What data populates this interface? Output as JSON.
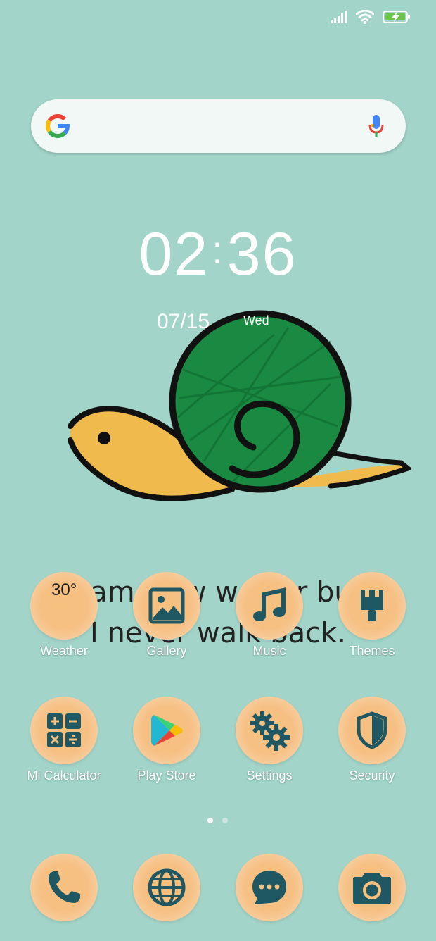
{
  "colors": {
    "background": "#a2d4c9",
    "icon_fill": "#f6c07e",
    "icon_glyph": "#1f5763",
    "battery": "#6ac744"
  },
  "status_bar": {
    "icons": [
      "signal-icon",
      "wifi-icon",
      "battery-charging-icon"
    ]
  },
  "search": {
    "logo": "google-g-logo",
    "mic": "microphone-icon"
  },
  "clock": {
    "hours": "02",
    "separator": ":",
    "minutes": "36",
    "date": "07/15",
    "weekday": "Wed"
  },
  "wallpaper": {
    "quote_line1": "I am slow walker but",
    "quote_line2": "I never walk back."
  },
  "apps_row1": [
    {
      "label": "Weather",
      "icon": "weather-icon",
      "value": "30°"
    },
    {
      "label": "Gallery",
      "icon": "gallery-icon"
    },
    {
      "label": "Music",
      "icon": "music-icon"
    },
    {
      "label": "Themes",
      "icon": "themes-icon"
    }
  ],
  "apps_row2": [
    {
      "label": "Mi Calculator",
      "icon": "calculator-icon"
    },
    {
      "label": "Play Store",
      "icon": "play-store-icon"
    },
    {
      "label": "Settings",
      "icon": "settings-icon"
    },
    {
      "label": "Security",
      "icon": "security-icon"
    }
  ],
  "page_indicator": {
    "count": 2,
    "active": 1
  },
  "dock": [
    {
      "icon": "phone-icon"
    },
    {
      "icon": "browser-icon"
    },
    {
      "icon": "messages-icon"
    },
    {
      "icon": "camera-icon"
    }
  ]
}
